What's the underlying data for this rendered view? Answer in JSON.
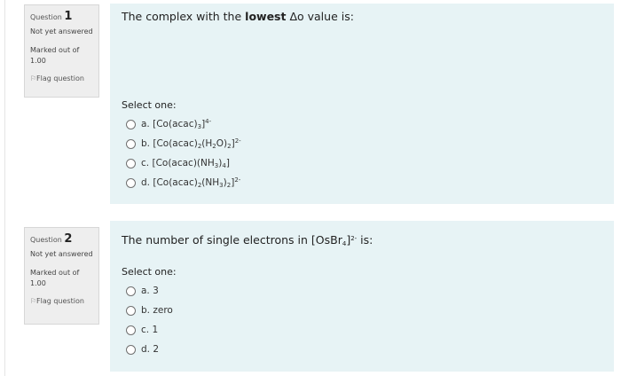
{
  "questions": [
    {
      "number_prefix": "Question",
      "number": "1",
      "state": "Not yet answered",
      "grade": "Marked out of 1.00",
      "flag_label": "Flag question",
      "text_before": "The complex with the ",
      "text_bold": "lowest",
      "text_after": " Δo value is:",
      "prompt": "Select one:",
      "options": [
        {
          "letter": "a.",
          "text": "[Co(acac)3]4-"
        },
        {
          "letter": "b.",
          "text": "[Co(acac)2(H2O)2]2-"
        },
        {
          "letter": "c.",
          "text": "[Co(acac)(NH3)4]"
        },
        {
          "letter": "d.",
          "text": "[Co(acac)2(NH3)2]2-"
        }
      ]
    },
    {
      "number_prefix": "Question",
      "number": "2",
      "state": "Not yet answered",
      "grade": "Marked out of 1.00",
      "flag_label": "Flag question",
      "text": "The number of single electrons in [OsBr4]2- is:",
      "prompt": "Select one:",
      "options": [
        {
          "letter": "a.",
          "text": "3"
        },
        {
          "letter": "b.",
          "text": "zero"
        },
        {
          "letter": "c.",
          "text": "1"
        },
        {
          "letter": "d.",
          "text": "2"
        }
      ]
    }
  ],
  "icons": {
    "flag": "flag-icon",
    "radio": "radio-button"
  },
  "colors": {
    "content_bg": "#e7f3f5",
    "info_bg": "#eeeeee"
  }
}
